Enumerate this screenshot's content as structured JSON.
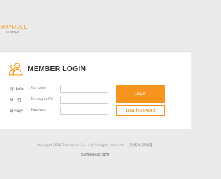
{
  "brand": {
    "logo_main": "PAYROLL",
    "logo_sub": "WORLD",
    "accent_color": "#f7941d"
  },
  "login": {
    "title": "MEMBER LOGIN",
    "title_icon": "users-icon",
    "fields": [
      {
        "label_ko": "회사코드",
        "label_en": "Company",
        "value": "",
        "placeholder": ""
      },
      {
        "label_ko": "사　번",
        "label_en": "Employee No",
        "value": "",
        "placeholder": ""
      },
      {
        "label_ko": "패스워드",
        "label_en": "Password",
        "value": "",
        "placeholder": ""
      }
    ],
    "label_separator": "|",
    "login_button": "Login",
    "lost_password_button": "Lost Password"
  },
  "footer": {
    "copyright": "copyright 2018 Trico Korea Co., Ltd. All rights reserved.",
    "privacy": "[개인정보처리방침]",
    "language": "[LANGUAGE SET]"
  }
}
